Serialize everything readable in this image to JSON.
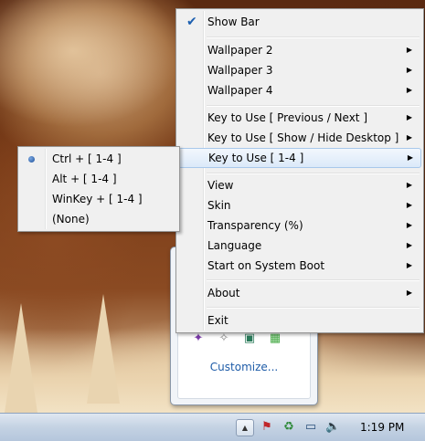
{
  "menu": {
    "items": [
      {
        "label": "Show Bar",
        "checked": true,
        "submenu": false
      },
      {
        "label": "Wallpaper 2",
        "submenu": true
      },
      {
        "label": "Wallpaper 3",
        "submenu": true
      },
      {
        "label": "Wallpaper 4",
        "submenu": true
      },
      {
        "label": "Key to Use [ Previous / Next ]",
        "submenu": true
      },
      {
        "label": "Key to Use [ Show / Hide Desktop ]",
        "submenu": true
      },
      {
        "label": "Key to Use [ 1-4 ]",
        "submenu": true,
        "highlighted": true
      },
      {
        "label": "View",
        "submenu": true
      },
      {
        "label": "Skin",
        "submenu": true
      },
      {
        "label": "Transparency (%)",
        "submenu": true
      },
      {
        "label": "Language",
        "submenu": true
      },
      {
        "label": "Start on System Boot",
        "submenu": true
      },
      {
        "label": "About",
        "submenu": true
      },
      {
        "label": "Exit",
        "submenu": false
      }
    ]
  },
  "submenu": {
    "items": [
      {
        "label": "Ctrl + [ 1-4 ]",
        "selected": true
      },
      {
        "label": "Alt + [ 1-4 ]"
      },
      {
        "label": "WinKey + [ 1-4 ]"
      },
      {
        "label": "(None)"
      }
    ]
  },
  "tray_flyout": {
    "customize_label": "Customize...",
    "icons": [
      "tray-app-icon-1",
      "tray-app-icon-2",
      "network-app-icon",
      "windows-grid-icon"
    ]
  },
  "taskbar": {
    "show_hidden_icons": "show-hidden-icons-arrow",
    "icons": [
      "action-center-flag-icon",
      "app-tray-icon",
      "network-icon",
      "volume-icon"
    ],
    "clock": "1:19 PM"
  },
  "colors": {
    "menu_bg": "#f0f0f0",
    "highlight_border": "#a8c8eb",
    "check_blue": "#1c5fb0",
    "link_blue": "#1e5ca8"
  }
}
